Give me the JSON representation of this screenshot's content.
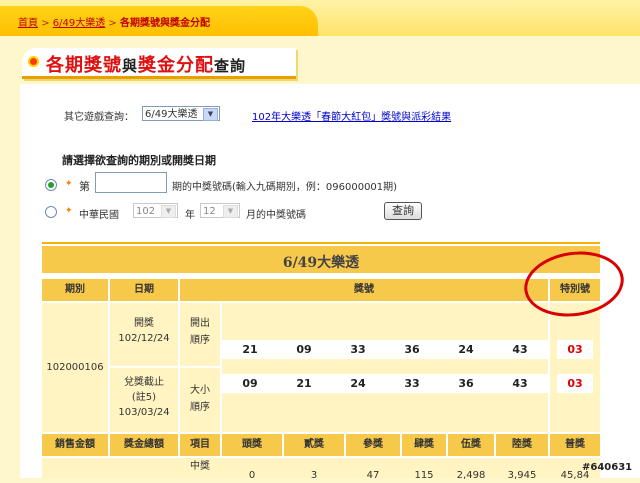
{
  "breadcrumb": {
    "home": "首頁",
    "sep": ">",
    "game": "6/49大樂透",
    "current": "各期獎號與獎金分配"
  },
  "page_title": {
    "part1": "各期獎號",
    "part2": "與",
    "part3": "獎金分配",
    "part4": "查詢"
  },
  "other_game": {
    "label": "其它遊戲查詢：",
    "selected": "6/49大樂透",
    "link": "102年大樂透「春節大紅包」獎號與派彩結果"
  },
  "query": {
    "heading": "請選擇欲查詢的期別或開獎日期",
    "option1_prefix": "第",
    "option1_suffix": "期的中獎號碼(輸入九碼期別，例：096000001期)",
    "option2_prefix": "中華民國",
    "year_value": "102",
    "year_unit": "年",
    "month_value": "12",
    "month_suffix": "月的中獎號碼",
    "button": "查詢"
  },
  "table": {
    "title": "6/49大樂透",
    "headers": {
      "period": "期別",
      "date": "日期",
      "numbers": "獎號",
      "special": "特別號"
    },
    "period": "102000106",
    "draw_label": "開獎",
    "draw_date": "102/12/24",
    "deadline_label1": "兌獎截止",
    "deadline_label2": "(註5)",
    "deadline_date": "103/03/24",
    "order1_a": "開出",
    "order1_b": "順序",
    "order2_a": "大小",
    "order2_b": "順序",
    "draw_order": [
      "21",
      "09",
      "33",
      "36",
      "24",
      "43"
    ],
    "size_order": [
      "09",
      "21",
      "24",
      "33",
      "36",
      "43"
    ],
    "special_number": "03",
    "lower_headers": [
      "銷售金額",
      "獎金總額",
      "項目",
      "頭獎",
      "貳獎",
      "參獎",
      "肆獎",
      "伍獎",
      "陸獎",
      "普獎"
    ],
    "lower_row_label": "中獎",
    "lower_row_values": [
      "0",
      "3",
      "47",
      "115",
      "2,498",
      "3,945",
      "45,84"
    ]
  },
  "watermark": "#640631"
}
